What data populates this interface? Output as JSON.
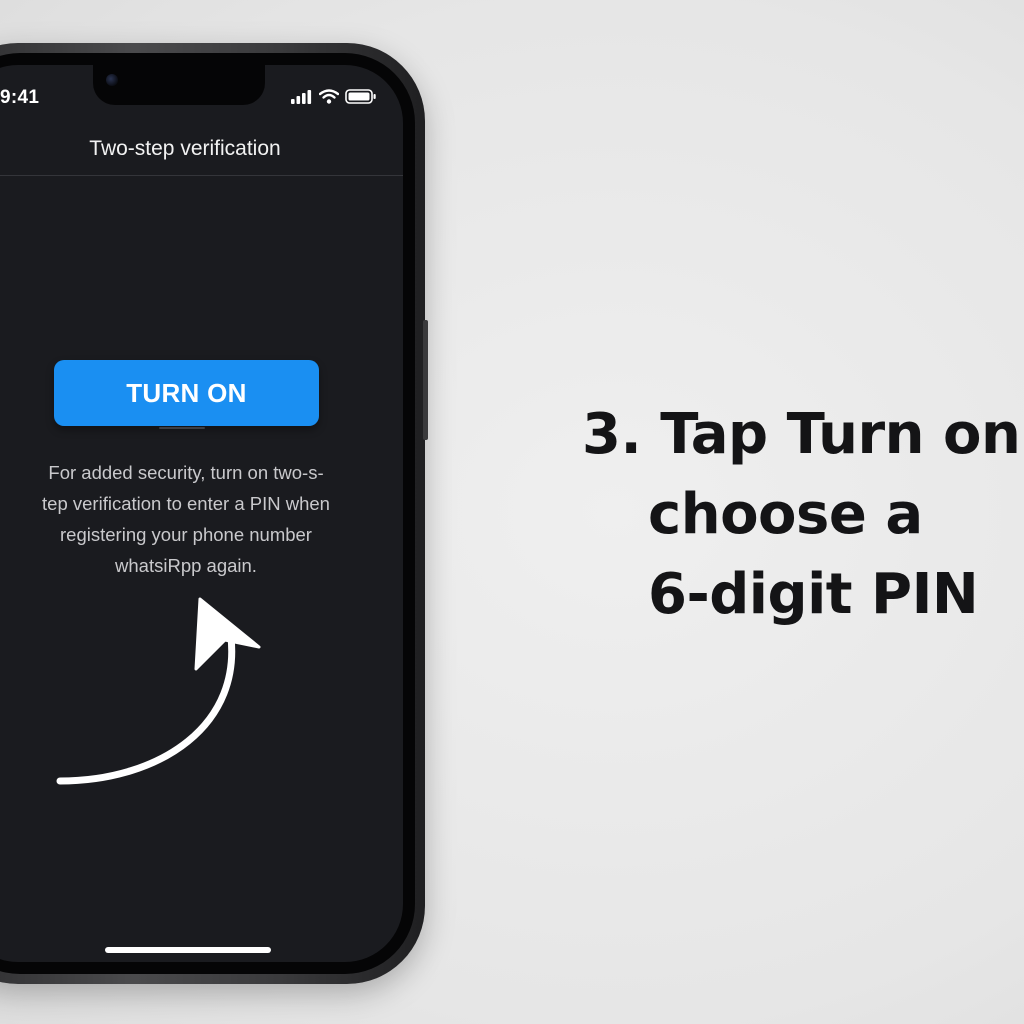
{
  "status_bar": {
    "time": "9:41",
    "icons": [
      "cellular-signal-icon",
      "wifi-icon",
      "battery-icon"
    ]
  },
  "screen": {
    "title": "Two-step verification",
    "turn_on_label": "TURN ON",
    "description_lines": [
      "For added security, turn on two-s-",
      "tep verification to enter a PIN when",
      "registering your phone number",
      "whatsiRpp again."
    ]
  },
  "caption": {
    "lines": [
      "3. Tap Turn on",
      "choose a",
      "6-digit PIN"
    ]
  },
  "colors": {
    "background": "#e9e9e9",
    "screen_bg": "#1a1b1f",
    "button_blue": "#1a8ff2",
    "caption_text": "#141416"
  }
}
